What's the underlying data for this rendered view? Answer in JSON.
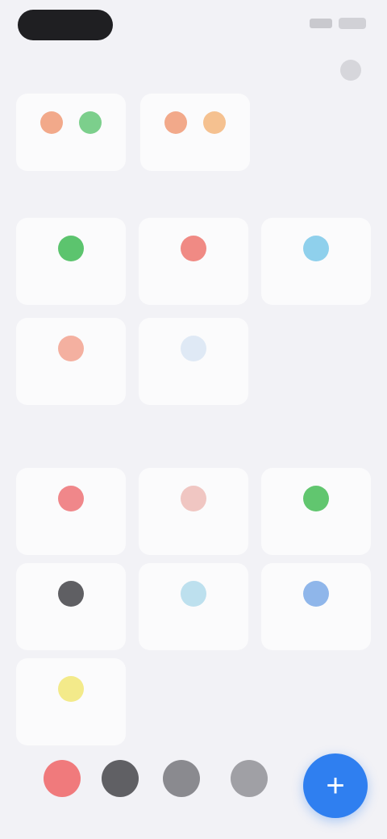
{
  "nav": {
    "title": ""
  },
  "pinned": [
    {
      "label": "",
      "icon_colors": [
        "#f2a98a",
        "#7ccf8c"
      ]
    },
    {
      "label": "",
      "icon_colors": [
        "#f2a98a",
        "#f5c190"
      ]
    }
  ],
  "section_one": {
    "title": "",
    "tiles": [
      {
        "label": "",
        "icon_name": "calendar-icon",
        "color": "#5cc46e"
      },
      {
        "label": "",
        "icon_name": "alert-icon",
        "color": "#f08a84"
      },
      {
        "label": "",
        "icon_name": "info-icon",
        "color": "#8fd0ec"
      },
      {
        "label": "",
        "icon_name": "flag-icon",
        "color": "#f4b0a0"
      },
      {
        "label": "",
        "icon_name": "list-icon",
        "color": "#dfe9f5"
      }
    ]
  },
  "section_two": {
    "title": "",
    "tiles": [
      {
        "label": "",
        "icon_name": "heart-icon",
        "color": "#f0878a"
      },
      {
        "label": "",
        "icon_name": "person-icon",
        "color": "#f0c6c2"
      },
      {
        "label": "",
        "icon_name": "check-icon",
        "color": "#61c66f"
      },
      {
        "label": "",
        "icon_name": "clock-icon",
        "color": "#5f5f63"
      },
      {
        "label": "",
        "icon_name": "cloud-icon",
        "color": "#bde0ee"
      },
      {
        "label": "",
        "icon_name": "star-icon",
        "color": "#8fb6ea"
      },
      {
        "label": "",
        "icon_name": "lightbulb-icon",
        "color": "#f3ea8a"
      }
    ]
  },
  "dock": {
    "buttons": [
      {
        "icon_name": "record-icon",
        "color": "#f07a7c"
      },
      {
        "icon_name": "camera-icon",
        "color": "#606064"
      },
      {
        "icon_name": "settings-icon",
        "color": "#8a8a8f"
      },
      {
        "icon_name": "share-icon",
        "color": "#a0a0a5"
      }
    ],
    "fab_icon": "plus-icon",
    "fab_color": "#2f7ff0"
  }
}
